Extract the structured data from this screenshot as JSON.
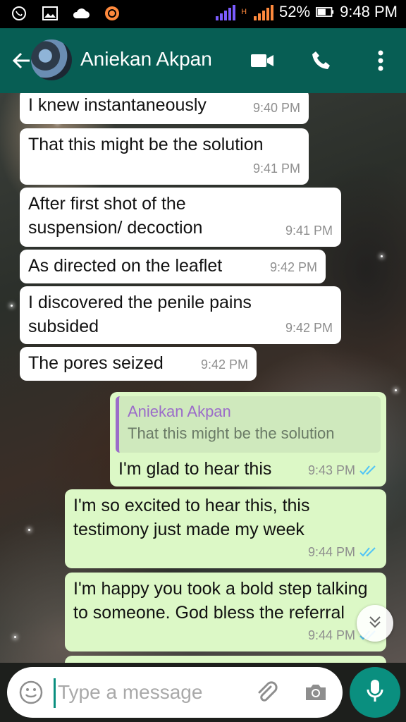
{
  "status_bar": {
    "battery_percent": "52%",
    "time": "9:48 PM",
    "network_label": "H"
  },
  "header": {
    "contact_name": "Aniekan Akpan",
    "icons": [
      "back-arrow-icon",
      "video-call-icon",
      "voice-call-icon",
      "more-options-icon"
    ]
  },
  "messages": [
    {
      "direction": "in",
      "text": "I knew instantaneously",
      "time": "9:40 PM"
    },
    {
      "direction": "in",
      "text": "That this might be the solution",
      "time": "9:41 PM"
    },
    {
      "direction": "in",
      "text": "After first shot of the suspension/ decoction",
      "time": "9:41 PM"
    },
    {
      "direction": "in",
      "text": "As directed on the leaflet",
      "time": "9:42 PM"
    },
    {
      "direction": "in",
      "text": "I discovered the penile pains subsided",
      "time": "9:42 PM"
    },
    {
      "direction": "in",
      "text": "The pores seized",
      "time": "9:42 PM"
    },
    {
      "direction": "out",
      "quote_author": "Aniekan Akpan",
      "quote_text": "That this might be the solution",
      "text": "I'm glad to hear this",
      "time": "9:43 PM",
      "read": true
    },
    {
      "direction": "out",
      "text": "I'm so excited to hear this, this testimony just made my week",
      "time": "9:44 PM",
      "read": true
    },
    {
      "direction": "out",
      "text": "I'm happy you took a bold step talking to someone. God bless the referral",
      "time": "9:44 PM",
      "read": true
    }
  ],
  "composer": {
    "placeholder": "Type a message"
  },
  "colors": {
    "header": "#075e54",
    "outgoing_bubble": "#dcf8c6",
    "incoming_bubble": "#ffffff",
    "read_ticks": "#4fc3f7",
    "mic_button": "#0a8f7f"
  }
}
